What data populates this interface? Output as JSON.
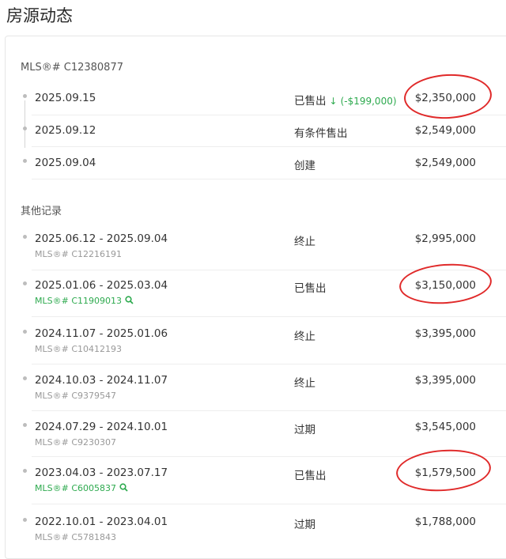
{
  "page_title": "房源动态",
  "current": {
    "mls": "MLS®# C12380877",
    "entries": [
      {
        "date": "2025.09.15",
        "status": "已售出",
        "arrow": "↓",
        "change": "(-$199,000)",
        "price": "$2,350,000"
      },
      {
        "date": "2025.09.12",
        "status": "有条件售出",
        "price": "$2,549,000"
      },
      {
        "date": "2025.09.04",
        "status": "创建",
        "price": "$2,549,000"
      }
    ]
  },
  "other": {
    "heading": "其他记录",
    "entries": [
      {
        "date": "2025.06.12 - 2025.09.04",
        "mls": "MLS®# C12216191",
        "status": "终止",
        "price": "$2,995,000"
      },
      {
        "date": "2025.01.06 - 2025.03.04",
        "mls": "MLS®# C11909013",
        "status": "已售出",
        "price": "$3,150,000"
      },
      {
        "date": "2024.11.07 - 2025.01.06",
        "mls": "MLS®# C10412193",
        "status": "终止",
        "price": "$3,395,000"
      },
      {
        "date": "2024.10.03 - 2024.11.07",
        "mls": "MLS®# C9379547",
        "status": "终止",
        "price": "$3,395,000"
      },
      {
        "date": "2024.07.29 - 2024.10.01",
        "mls": "MLS®# C9230307",
        "status": "过期",
        "price": "$3,545,000"
      },
      {
        "date": "2023.04.03 - 2023.07.17",
        "mls": "MLS®# C6005837",
        "status": "已售出",
        "price": "$1,579,500"
      },
      {
        "date": "2022.10.01 - 2023.04.01",
        "mls": "MLS®# C5781843",
        "status": "过期",
        "price": "$1,788,000"
      }
    ]
  },
  "colors": {
    "accent_green": "#2eaa4f",
    "annotation_red": "#e02a2a"
  }
}
